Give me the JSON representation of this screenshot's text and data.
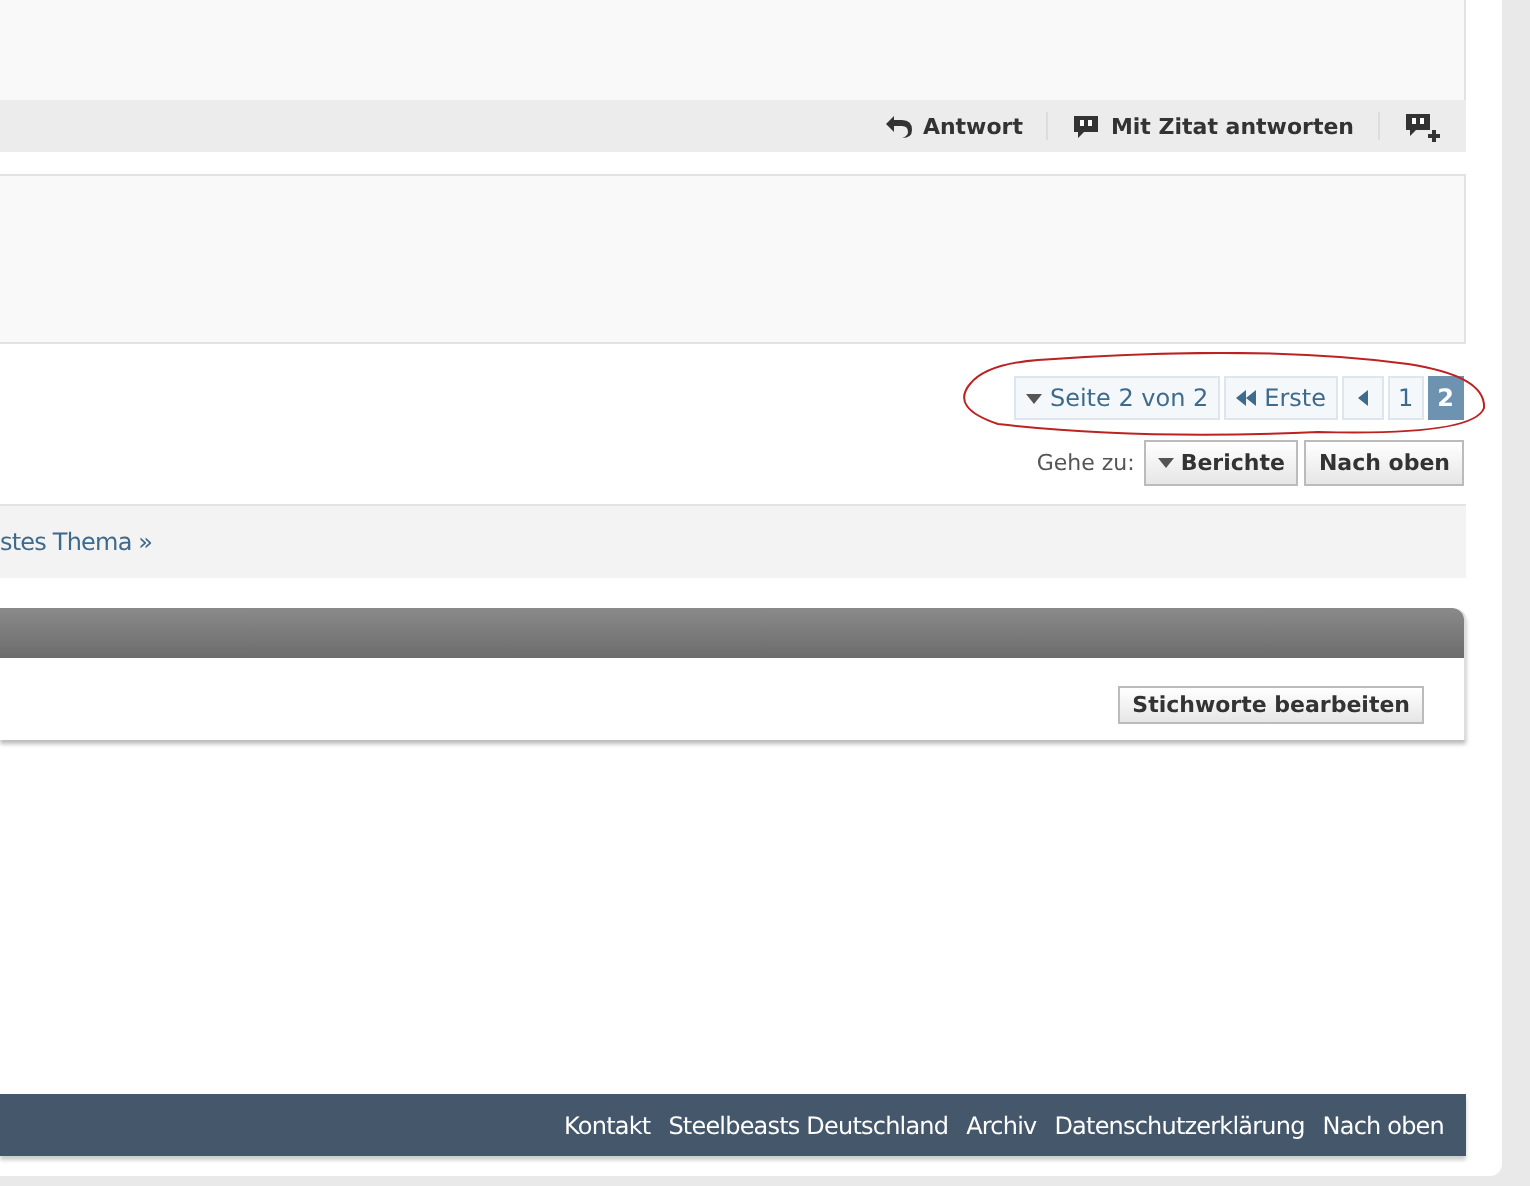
{
  "post_actions": [
    {
      "label": "Antwort",
      "kind": "reply"
    },
    {
      "label": "Mit Zitat antworten",
      "kind": "quote"
    },
    {
      "kind": "multiquote"
    }
  ],
  "pagination": {
    "summary": "Seite 2 von 2",
    "first": "Erste",
    "pages": [
      {
        "label": "1",
        "selected": false
      },
      {
        "label": "2",
        "selected": true
      }
    ]
  },
  "goto": {
    "label": "Gehe zu:",
    "buttons": [
      {
        "label": "Berichte",
        "kind": "dropdown"
      },
      {
        "label": "Nach oben",
        "kind": "plain"
      }
    ]
  },
  "thread_nav": {
    "next": "stes Thema »"
  },
  "tags": {
    "edit_button": "Stichworte bearbeiten"
  },
  "footer": {
    "links": [
      "Kontakt",
      "Steelbeasts Deutschland",
      "Archiv",
      "Datenschutzerklärung",
      "Nach oben"
    ]
  }
}
